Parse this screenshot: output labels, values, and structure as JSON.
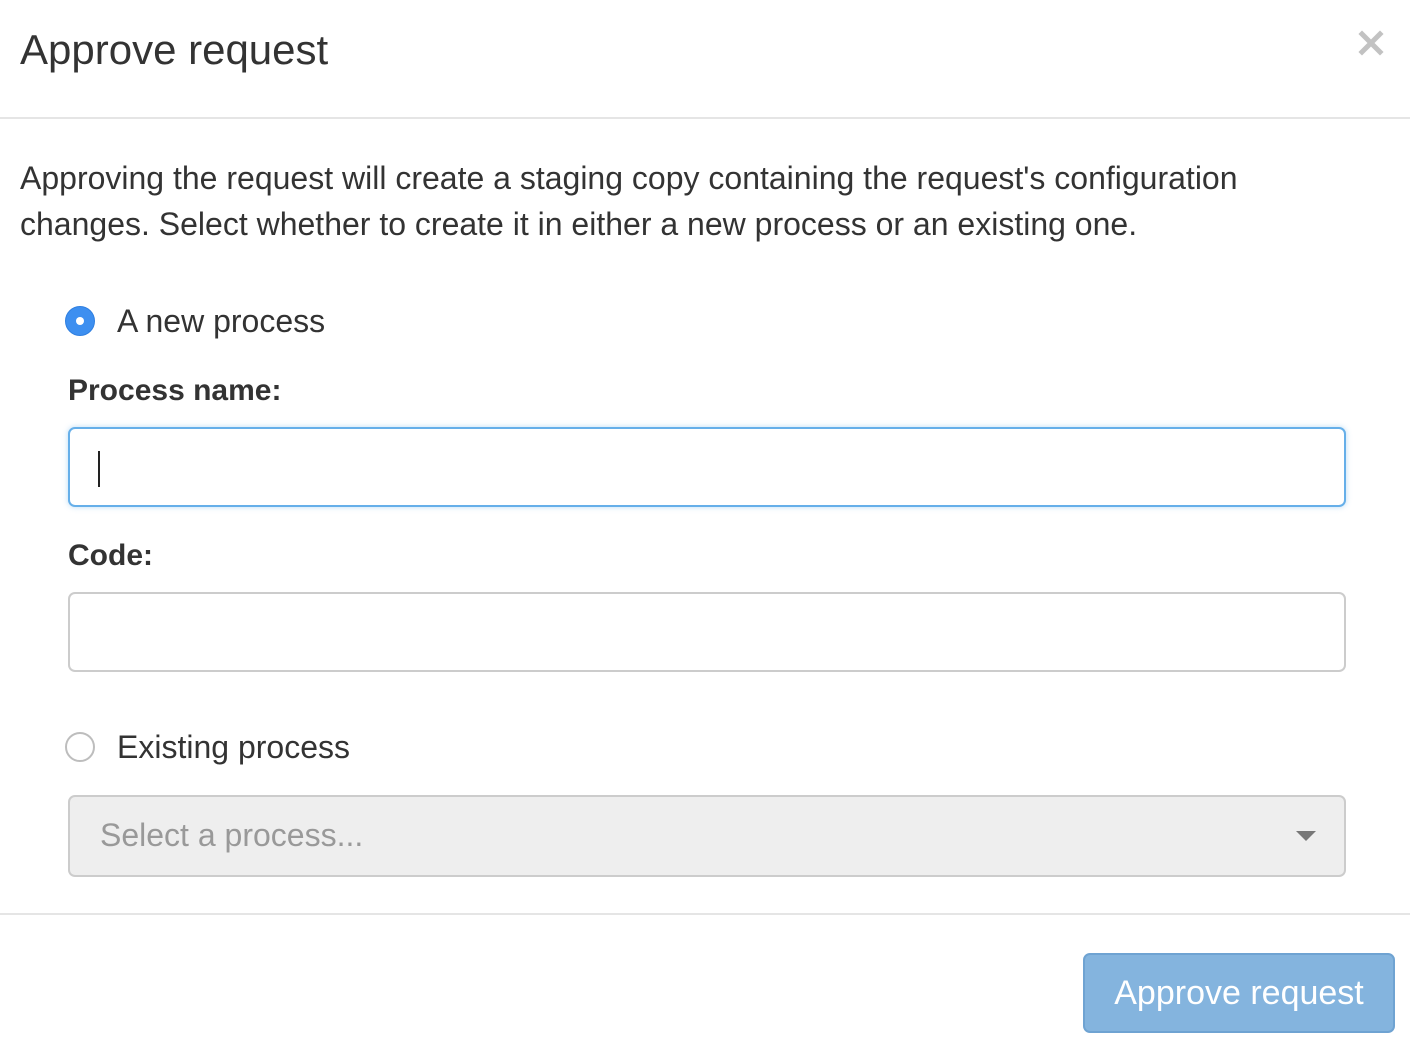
{
  "dialog": {
    "title": "Approve request",
    "close_icon": "close-icon"
  },
  "body": {
    "intro": "Approving the request will create a staging copy containing the request's configuration changes. Select whether to create it in either a new process or an existing one.",
    "options": [
      {
        "label": "A new process",
        "checked": true
      },
      {
        "label": "Existing process",
        "checked": false
      }
    ],
    "process_name": {
      "label": "Process name:",
      "value": ""
    },
    "code": {
      "label": "Code:",
      "value": ""
    },
    "existing_select": {
      "placeholder": "Select a process...",
      "disabled": true
    }
  },
  "footer": {
    "approve_label": "Approve request",
    "approve_disabled": true
  },
  "colors": {
    "accent": "#3d8ff0",
    "focus_border": "#66afe9",
    "primary_button_disabled": "#84b4de"
  }
}
